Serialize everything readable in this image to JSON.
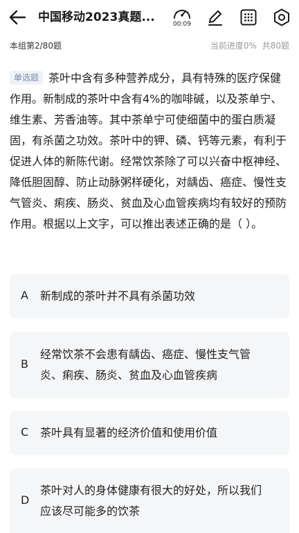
{
  "header": {
    "title": "中国移动2023真题...",
    "timer": "00:09"
  },
  "progress_bar": {
    "group_label": "本组第2/80题",
    "progress_label": "当前进度0%",
    "total_label": "共80题"
  },
  "question": {
    "type_badge": "单选题",
    "text": "茶叶中含有多种营养成分，具有特殊的医疗保健作用。新制成的茶叶中含有4%的咖啡碱，以及茶单宁、维生素、芳香油等。其中茶单宁可使细菌中的蛋白质凝固，有杀菌之功效。茶叶中的钾、磷、钙等元素，有利于促进人体的新陈代谢。经常饮茶除了可以兴奋中枢神经、降低胆固醇、防止动脉粥样硬化，对龋齿、癌症、慢性支气管炎、痢疾、肠炎、贫血及心血管疾病均有较好的预防作用。根据以上文字，可以推出表述正确的是（ ）。"
  },
  "options": [
    {
      "letter": "A",
      "text": "新制成的茶叶并不具有杀菌功效"
    },
    {
      "letter": "B",
      "text": "经常饮茶不会患有龋齿、癌症、慢性支气管炎、痢疾、肠炎、贫血及心血管疾病"
    },
    {
      "letter": "C",
      "text": "茶叶具有显著的经济价值和使用价值"
    },
    {
      "letter": "D",
      "text": "茶叶对人的身体健康有很大的好处，所以我们应该尽可能多的饮茶"
    }
  ],
  "icons": {
    "back": "arrow-left-icon",
    "timer": "speedometer-timer-icon",
    "edit": "pencil-icon",
    "grid": "answer-sheet-grid-icon",
    "settings": "gear-icon"
  },
  "colors": {
    "badge_bg": "#eef2f9",
    "badge_text": "#7a8aa6",
    "option_bg": "#f5f6f8",
    "muted_text": "#9a9a9a"
  }
}
